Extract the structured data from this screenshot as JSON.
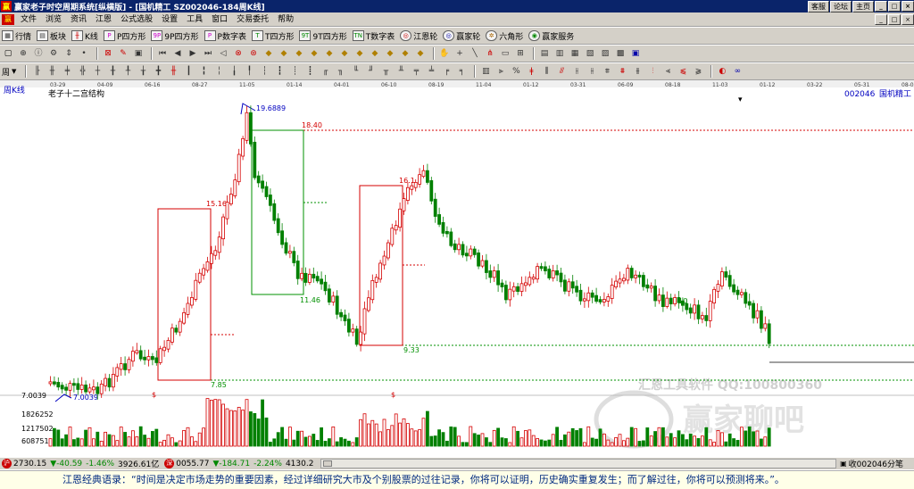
{
  "window": {
    "title": "赢家老子时空周期系统[纵横版] - [国机精工   SZ002046-184周K线]",
    "links": [
      "客服",
      "论坛",
      "主页"
    ],
    "controls": [
      "_",
      "□",
      "×"
    ]
  },
  "menu": {
    "items": [
      "文件",
      "浏览",
      "资讯",
      "江恩",
      "公式选股",
      "设置",
      "工具",
      "窗口",
      "交易委托",
      "帮助"
    ],
    "right": [
      "_",
      "□",
      "×"
    ]
  },
  "toolbar1": {
    "items": [
      {
        "icon": "grid-icon",
        "label": "行情"
      },
      {
        "icon": "sector-icon",
        "label": "板块"
      },
      {
        "icon": "kline-icon",
        "label": "K线"
      },
      {
        "icon": "p-square-icon",
        "label": "P四方形"
      },
      {
        "icon": "9p-square-icon",
        "label": "9P四方形"
      },
      {
        "icon": "p-number-icon",
        "label": "P数字表"
      },
      {
        "icon": "t-square-icon",
        "label": "T四方形"
      },
      {
        "icon": "9t-square-icon",
        "label": "9T四方形"
      },
      {
        "icon": "t-number-icon",
        "label": "T数字表"
      },
      {
        "icon": "gann-wheel-icon",
        "label": "江恩轮"
      },
      {
        "icon": "winner-wheel-icon",
        "label": "赢家轮"
      },
      {
        "icon": "hexagon-icon",
        "label": "六角形"
      },
      {
        "icon": "service-icon",
        "label": "赢家服务"
      }
    ]
  },
  "toolbar3": {
    "period_label": "周"
  },
  "chart": {
    "period_tag": "周K线",
    "pattern_title": "老子十二宫结构",
    "stock_code": "002046",
    "stock_name": "国机精工",
    "date_ticks": [
      "03-29",
      "04-09",
      "06-16",
      "08-27",
      "11-05",
      "01-14",
      "04-01",
      "06-10",
      "08-19",
      "11-04",
      "01-12",
      "03-31",
      "06-09",
      "08-18",
      "11-03",
      "01-12",
      "03-22",
      "05-31",
      "08-09"
    ],
    "price_labels": {
      "high": "19.6889",
      "r1": "18.40",
      "b1": "15.16",
      "b2": "16.1",
      "s1": "11.46",
      "s2": "9.33",
      "s3": "7.85",
      "low": "7.0039",
      "axis_low": "7.0039",
      "mid": "10"
    },
    "volume_ticks": [
      "1826252",
      "1217502",
      "608751"
    ],
    "watermark": "汇恩工具软件  QQ:100800360",
    "watermark2": "赢家聊吧",
    "markers": [
      "$",
      "$"
    ]
  },
  "indexbar": {
    "sh_value": "2730.15",
    "sh_change": "▼-40.59",
    "sh_pct": "-1.46%",
    "sh_amount": "3926.61亿",
    "sz_value": "0055.77",
    "sz_change": "▼-184.71",
    "sz_pct": "-2.24%",
    "sz_amount": "4130.2",
    "right_label": "收002046分笔"
  },
  "footer": {
    "quote": "江恩经典语录：“时间是决定市场走势的重要因素，经过详细研究大市及个别股票的过往记录，你将可以证明，历史确实重复发生；而了解过往，你将可以预测将来。”。"
  },
  "colors": {
    "up": "#d40000",
    "down": "#008000",
    "guide_red": "#d40000",
    "guide_green": "#009000",
    "blue": "#0000c0"
  }
}
